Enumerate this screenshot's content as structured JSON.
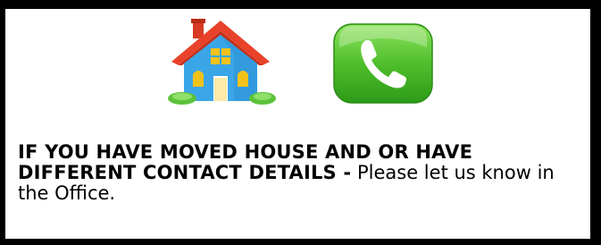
{
  "icons": {
    "home": "house-icon",
    "phone": "phone-icon"
  },
  "colors": {
    "house_roof": "#e8432a",
    "house_wall": "#3aa6e8",
    "house_window": "#f2c21b",
    "bush": "#5cc23a",
    "phone_bg": "#4fbf2c",
    "text": "#000000"
  },
  "notice": {
    "heading": "IF YOU HAVE MOVED HOUSE AND OR HAVE DIFFERENT CONTACT DETAILS  -",
    "message": " Please let us know in the Office."
  }
}
